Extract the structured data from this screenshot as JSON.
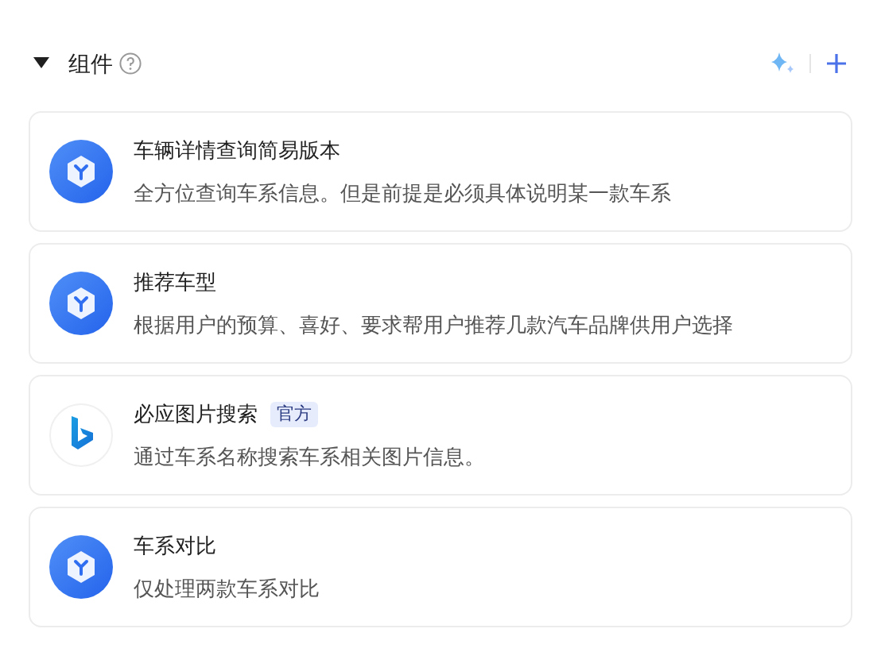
{
  "section": {
    "title": "组件",
    "expanded": true
  },
  "components": [
    {
      "kind": "plugin",
      "name": "车辆详情查询简易版本",
      "description": "全方位查询车系信息。但是前提是必须具体说明某一款车系"
    },
    {
      "kind": "plugin",
      "name": "推荐车型",
      "description": "根据用户的预算、喜好、要求帮用户推荐几款汽车品牌供用户选择"
    },
    {
      "kind": "bing",
      "name": "必应图片搜索",
      "badge": "官方",
      "description": "通过车系名称搜索车系相关图片信息。"
    },
    {
      "kind": "plugin",
      "name": "车系对比",
      "description": "仅处理两款车系对比"
    }
  ]
}
